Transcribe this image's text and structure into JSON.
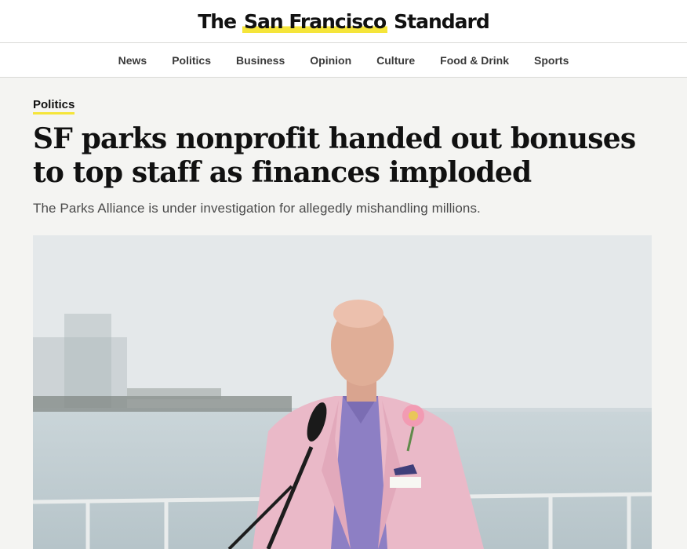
{
  "masthead": {
    "logo_the": "The",
    "logo_highlight": "San Francisco",
    "logo_standard": "Standard"
  },
  "nav": {
    "items": [
      {
        "label": "News"
      },
      {
        "label": "Politics"
      },
      {
        "label": "Business"
      },
      {
        "label": "Opinion"
      },
      {
        "label": "Culture"
      },
      {
        "label": "Food & Drink"
      },
      {
        "label": "Sports"
      }
    ]
  },
  "article": {
    "section": "Politics",
    "headline": "SF parks nonprofit handed out bonuses to top staff as finances imploded",
    "dek": "The Parks Alliance is under investigation for allegedly mishandling millions."
  },
  "colors": {
    "accent": "#f5e53a",
    "background": "#f4f4f2"
  }
}
